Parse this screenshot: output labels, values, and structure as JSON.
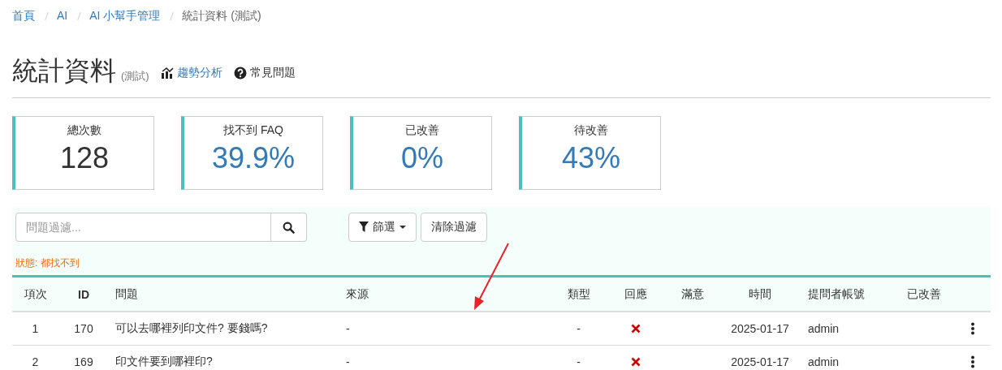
{
  "breadcrumb": [
    {
      "label": "首頁",
      "current": false
    },
    {
      "label": "AI",
      "current": false
    },
    {
      "label": "AI 小幫手管理",
      "current": false
    },
    {
      "label": "統計資料 (測試)",
      "current": true
    }
  ],
  "header": {
    "title": "統計資料",
    "subtitle": "(測試)",
    "links": [
      {
        "label": "趨勢分析",
        "kind": "chart"
      },
      {
        "label": "常見問題",
        "kind": "help"
      }
    ]
  },
  "stats": [
    {
      "label": "總次數",
      "value": "128",
      "color": "#333333"
    },
    {
      "label": "找不到 FAQ",
      "value": "39.9%",
      "color": "#337ab7"
    },
    {
      "label": "已改善",
      "value": "0%",
      "color": "#337ab7"
    },
    {
      "label": "待改善",
      "value": "43%",
      "color": "#337ab7"
    }
  ],
  "filter": {
    "placeholder": "問題過濾...",
    "filter_button": "篩選",
    "clear_button": "清除過濾",
    "status": "狀態: 都找不到"
  },
  "table": {
    "columns": [
      "項次",
      "ID",
      "問題",
      "來源",
      "類型",
      "回應",
      "滿意",
      "時間",
      "提問者帳號",
      "已改善"
    ],
    "rows": [
      {
        "index": "1",
        "id": "170",
        "question": "可以去哪裡列印文件? 要錢嗎?",
        "source": "-",
        "type": "-",
        "answered": false,
        "time": "2025-01-17",
        "user": "admin"
      },
      {
        "index": "2",
        "id": "169",
        "question": "印文件要到哪裡印?",
        "source": "-",
        "type": "-",
        "answered": false,
        "time": "2025-01-17",
        "user": "admin"
      }
    ]
  }
}
